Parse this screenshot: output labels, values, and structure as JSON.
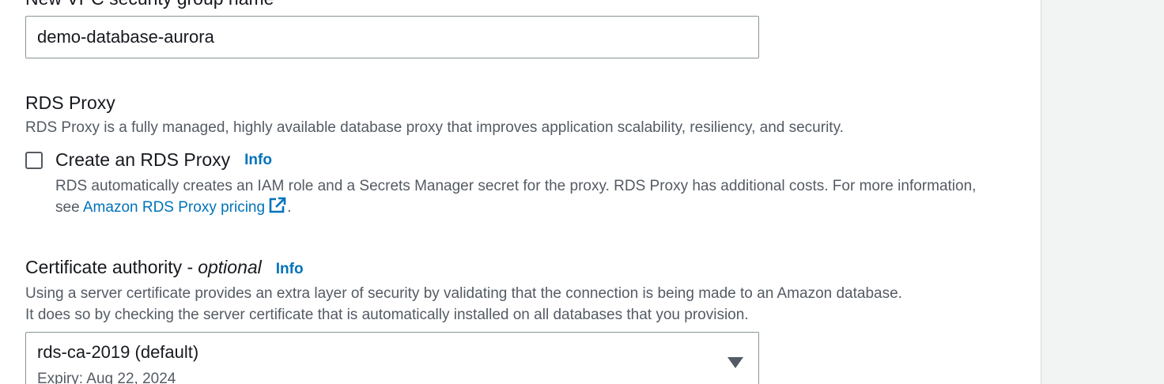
{
  "security_group": {
    "label": "New VPC security group name",
    "value": "demo-database-aurora"
  },
  "rds_proxy": {
    "heading": "RDS Proxy",
    "description": "RDS Proxy is a fully managed, highly available database proxy that improves application scalability, resiliency, and security.",
    "checkbox_label": "Create an RDS Proxy",
    "checked": false,
    "info_label": "Info",
    "note_text": "RDS automatically creates an IAM role and a Secrets Manager secret for the proxy. RDS Proxy has additional costs. For more information, see ",
    "pricing_link": "Amazon RDS Proxy pricing",
    "note_end": ".",
    "link_icon": "external-link-icon"
  },
  "certificate_authority": {
    "label": "Certificate authority - ",
    "optional": "optional",
    "info_label": "Info",
    "description_line1": "Using a server certificate provides an extra layer of security by validating that the connection is being made to an Amazon database.",
    "description_line2": "It does so by checking the server certificate that is automatically installed on all databases that you provision.",
    "selected_value": "rds-ca-2019 (default)",
    "selected_sub": "Expiry: Aug 22, 2024",
    "caret_icon": "caret-down-icon"
  },
  "colors": {
    "link": "#0073bb",
    "text": "#16191f",
    "muted": "#545b64",
    "border": "#879596",
    "panel": "#f2f3f3"
  }
}
